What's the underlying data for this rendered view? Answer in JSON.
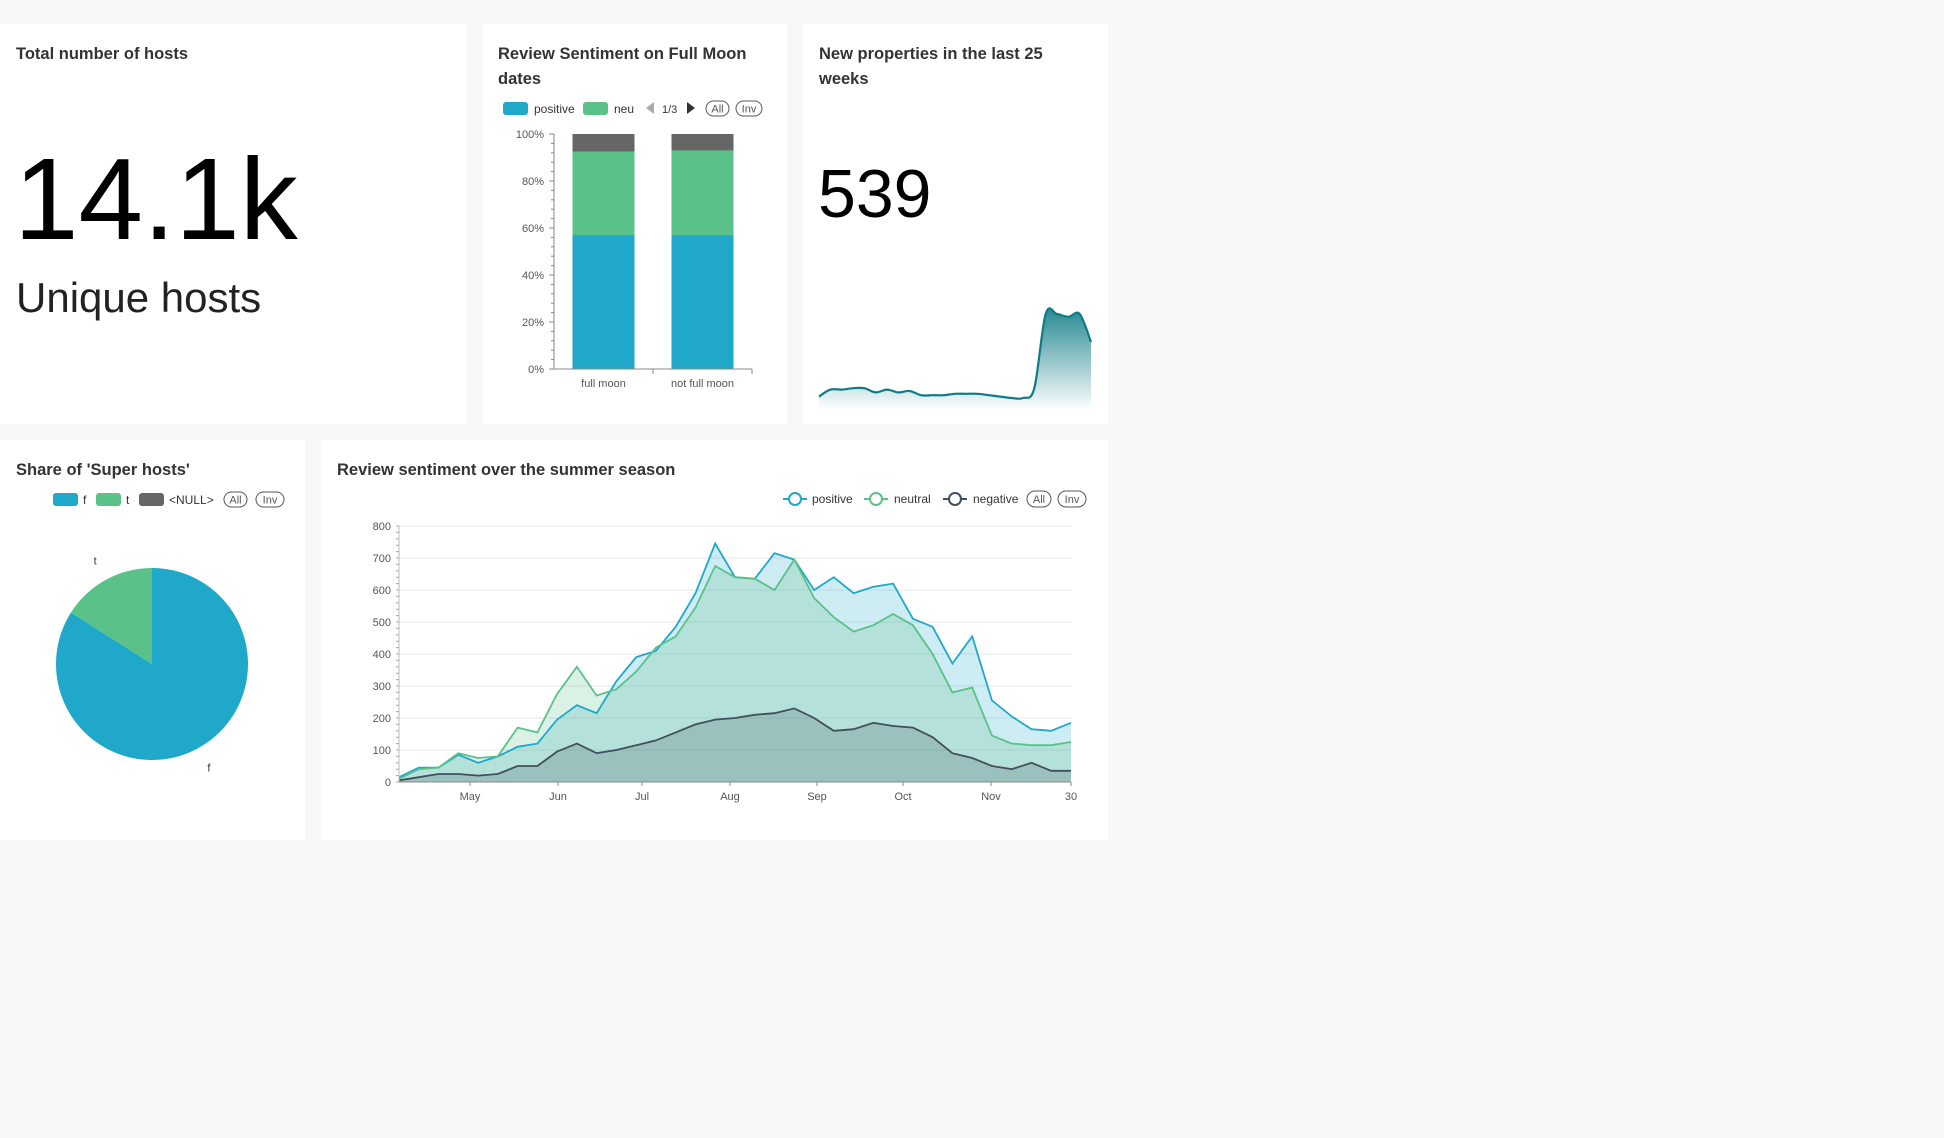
{
  "hosts_card": {
    "title": "Total number of hosts",
    "value": "14.1k",
    "subheader": "Unique hosts"
  },
  "moon_card": {
    "title_line1": "Review Sentiment on Full Moon",
    "title_line2": "dates",
    "legend": {
      "items": [
        {
          "label": "positive",
          "color": "#1FA8C9"
        },
        {
          "label": "neu",
          "color": "#5AC189"
        }
      ],
      "page": "1/3",
      "all_label": "All",
      "inv_label": "Inv"
    }
  },
  "newprops_card": {
    "title_line1": "New properties in the last 25",
    "title_line2": "weeks",
    "value": "539"
  },
  "super_card": {
    "title": "Share of 'Super hosts'",
    "legend": {
      "items": [
        {
          "label": "f",
          "color": "#1FA8C9"
        },
        {
          "label": "t",
          "color": "#5AC189"
        },
        {
          "label": "<NULL>",
          "color": "#666666"
        }
      ],
      "all_label": "All",
      "inv_label": "Inv"
    }
  },
  "summer_card": {
    "title": "Review sentiment over the summer season",
    "legend": {
      "items": [
        {
          "label": "positive",
          "color": "#1FA8C9"
        },
        {
          "label": "neutral",
          "color": "#5AC189"
        },
        {
          "label": "negative",
          "color": "#454E5C"
        }
      ],
      "all_label": "All",
      "inv_label": "Inv"
    }
  },
  "chart_data": [
    {
      "type": "bar",
      "stacked_percent": true,
      "categories": [
        "full moon",
        "not full moon"
      ],
      "series": [
        {
          "name": "positive",
          "color": "#1FA8C9",
          "values": [
            57,
            57
          ]
        },
        {
          "name": "neutral",
          "color": "#5AC189",
          "values": [
            35.5,
            36
          ]
        },
        {
          "name": "negative",
          "color": "#666666",
          "values": [
            7.5,
            7
          ]
        }
      ],
      "y_ticks": [
        "0%",
        "20%",
        "40%",
        "60%",
        "80%",
        "100%"
      ],
      "ylim": [
        0,
        100
      ]
    },
    {
      "type": "area",
      "description": "trendline",
      "color": "#0E7C86",
      "values": [
        0.5,
        3,
        3,
        3.5,
        3.5,
        2,
        3,
        2,
        2.5,
        1,
        1,
        1,
        1.5,
        1.5,
        1.5,
        1,
        0.5,
        0,
        0,
        3.5,
        30,
        30,
        29,
        30,
        20
      ]
    },
    {
      "type": "pie",
      "categories": [
        "f",
        "t",
        "<NULL>"
      ],
      "values": [
        84,
        16,
        0
      ],
      "colors": [
        "#1FA8C9",
        "#5AC189",
        "#666666"
      ]
    },
    {
      "type": "area",
      "x_ticks": [
        "May",
        "Jun",
        "Jul",
        "Aug",
        "Sep",
        "Oct",
        "Nov",
        "30"
      ],
      "y_ticks": [
        "0",
        "100",
        "200",
        "300",
        "400",
        "500",
        "600",
        "700",
        "800"
      ],
      "ylim": [
        0,
        800
      ],
      "series": [
        {
          "name": "positive",
          "color": "#1FA8C9",
          "values": [
            15,
            45,
            45,
            85,
            60,
            80,
            110,
            120,
            195,
            240,
            215,
            315,
            390,
            410,
            485,
            590,
            745,
            640,
            635,
            715,
            695,
            600,
            640,
            590,
            610,
            620,
            510,
            485,
            370,
            455,
            255,
            205,
            165,
            160,
            185
          ]
        },
        {
          "name": "neutral",
          "color": "#5AC189",
          "values": [
            10,
            40,
            45,
            90,
            75,
            80,
            170,
            155,
            275,
            360,
            270,
            290,
            345,
            420,
            455,
            545,
            675,
            640,
            635,
            600,
            695,
            575,
            515,
            470,
            490,
            525,
            490,
            400,
            280,
            295,
            145,
            120,
            115,
            115,
            125
          ]
        },
        {
          "name": "negative",
          "color": "#454E5C",
          "values": [
            5,
            15,
            25,
            25,
            20,
            25,
            50,
            50,
            95,
            120,
            90,
            100,
            115,
            130,
            155,
            180,
            195,
            200,
            210,
            215,
            230,
            200,
            160,
            165,
            185,
            175,
            170,
            140,
            90,
            75,
            50,
            40,
            60,
            35,
            35
          ]
        }
      ]
    }
  ]
}
